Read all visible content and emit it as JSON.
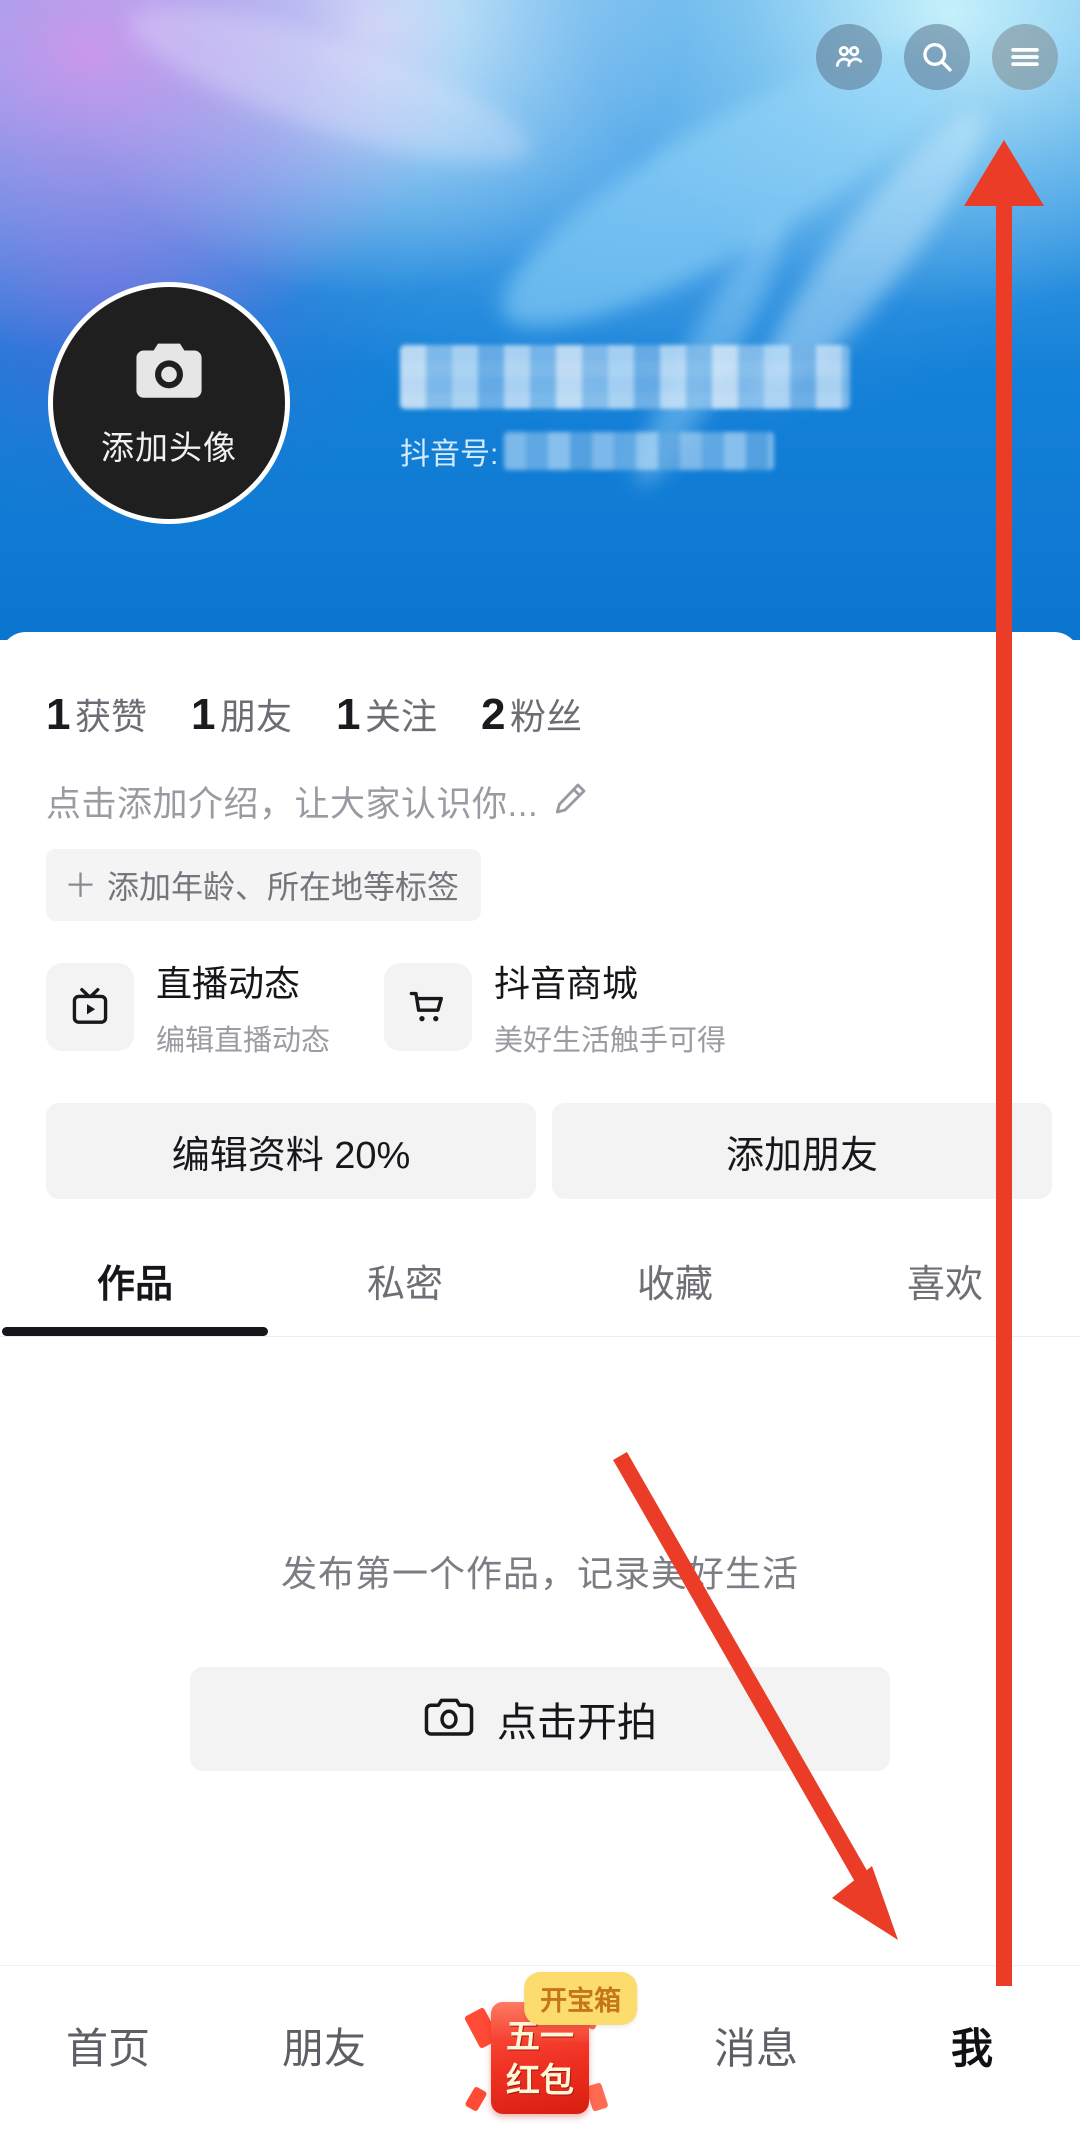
{
  "header": {
    "icons": [
      {
        "name": "friends-icon",
        "label": "朋友"
      },
      {
        "name": "search-icon",
        "label": "搜索"
      },
      {
        "name": "hamburger-menu-icon",
        "label": "菜单"
      }
    ],
    "avatar_label": "添加头像",
    "username": "",
    "douyin_id_label": "抖音号:",
    "douyin_id_value": ""
  },
  "stats": [
    {
      "num": "1",
      "label": "获赞"
    },
    {
      "num": "1",
      "label": "朋友"
    },
    {
      "num": "1",
      "label": "关注"
    },
    {
      "num": "2",
      "label": "粉丝"
    }
  ],
  "bio": {
    "placeholder": "点击添加介绍，让大家认识你...",
    "edit_icon": "pencil-icon",
    "tag_plus": "＋",
    "tag_label": "添加年龄、所在地等标签"
  },
  "feature_cards": [
    {
      "icon": "live-tv-icon",
      "title": "直播动态",
      "subtitle": "编辑直播动态"
    },
    {
      "icon": "shopping-cart-icon",
      "title": "抖音商城",
      "subtitle": "美好生活触手可得"
    }
  ],
  "actions": {
    "edit_profile": "编辑资料 20%",
    "add_friend": "添加朋友"
  },
  "tabs": [
    {
      "label": "作品",
      "active": true
    },
    {
      "label": "私密",
      "active": false
    },
    {
      "label": "收藏",
      "active": false
    },
    {
      "label": "喜欢",
      "active": false
    }
  ],
  "empty_state": {
    "text": "发布第一个作品，记录美好生活",
    "button_icon": "camera-icon",
    "button_label": "点击开拍"
  },
  "bottom_nav": {
    "items": [
      {
        "label": "首页",
        "active": false
      },
      {
        "label": "朋友",
        "active": false
      },
      {
        "label": "消息",
        "active": false
      },
      {
        "label": "我",
        "active": true
      }
    ],
    "redpacket": {
      "char_top": "五一",
      "char_bottom": "红包",
      "badge": "开宝箱"
    }
  },
  "annotations": {
    "arrow_color": "#ea3c26",
    "arrow_up_target": "hamburger-menu-icon",
    "arrow_down_target": "shoot-button"
  },
  "colors": {
    "cover_blue": "#0b76d0",
    "accent_red": "#ea3c26",
    "chip_gray": "#f3f3f4",
    "text_dark": "#16161a",
    "text_muted": "#9a9aa2",
    "badge_yellow": "#fbdc6d"
  }
}
